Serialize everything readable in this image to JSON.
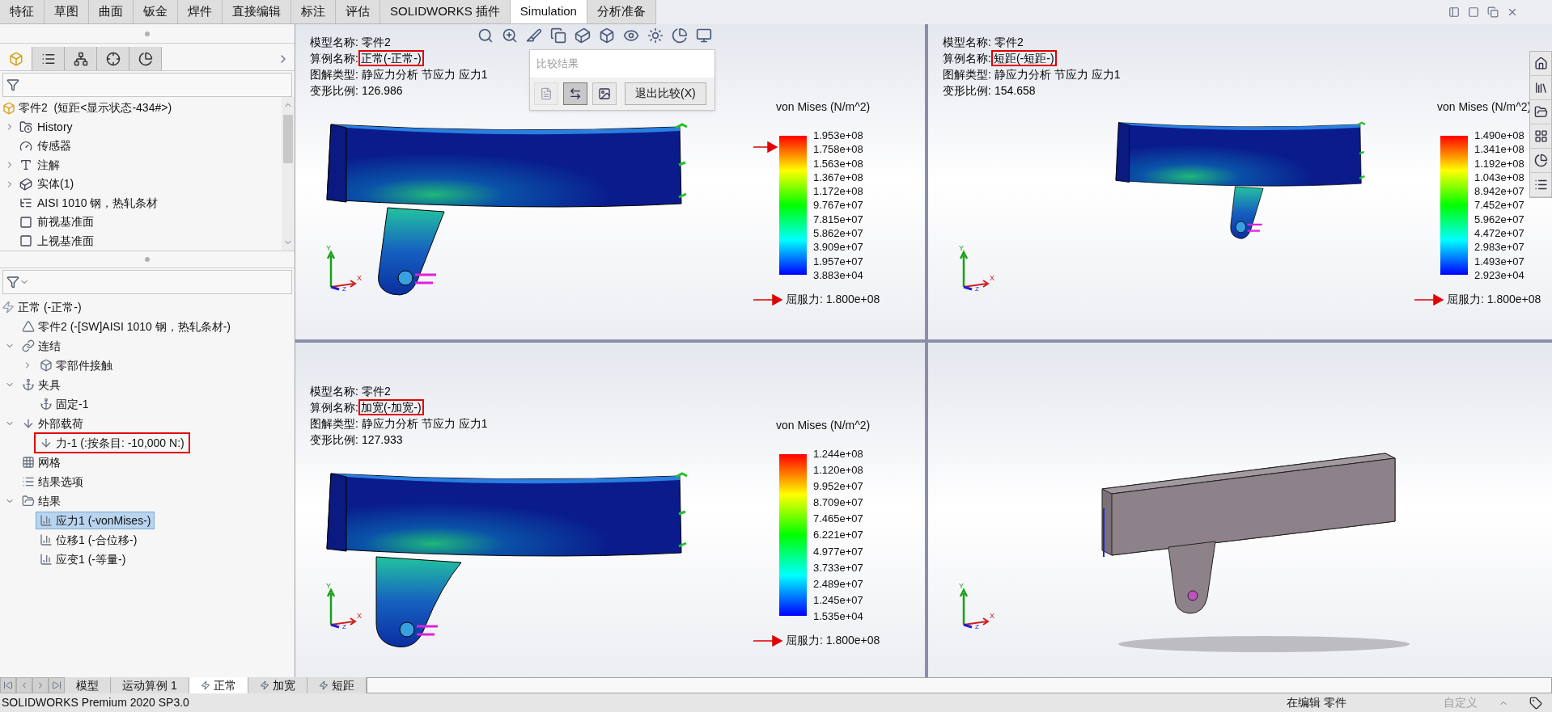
{
  "command_tabs": [
    {
      "label": "特征",
      "selected": false
    },
    {
      "label": "草图",
      "selected": false
    },
    {
      "label": "曲面",
      "selected": false
    },
    {
      "label": "钣金",
      "selected": false
    },
    {
      "label": "焊件",
      "selected": false
    },
    {
      "label": "直接编辑",
      "selected": false
    },
    {
      "label": "标注",
      "selected": false
    },
    {
      "label": "评估",
      "selected": false
    },
    {
      "label": "SOLIDWORKS 插件",
      "selected": false
    },
    {
      "label": "Simulation",
      "selected": true
    },
    {
      "label": "分析准备",
      "selected": false
    }
  ],
  "panel_tabs": [
    {
      "kind": "feature",
      "selected": true
    },
    {
      "kind": "property",
      "selected": false
    },
    {
      "kind": "config",
      "selected": false
    },
    {
      "kind": "dimxpert",
      "selected": false
    },
    {
      "kind": "display",
      "selected": false
    }
  ],
  "feature_tree": {
    "root": "零件2  (短距<显示状态-434#>)",
    "items": [
      {
        "label": "History",
        "kind": "history",
        "expanded": false
      },
      {
        "label": "传感器",
        "kind": "sensor"
      },
      {
        "label": "注解",
        "kind": "annotation",
        "expanded": false
      },
      {
        "label": "实体(1)",
        "kind": "solid",
        "expanded": false
      },
      {
        "label": "AISI 1010 钢，热轧条材",
        "kind": "material"
      },
      {
        "label": "前视基准面",
        "kind": "plane"
      },
      {
        "label": "上视基准面",
        "kind": "plane"
      }
    ]
  },
  "simulation_tree": {
    "root": "正常 (-正常-)",
    "items": [
      {
        "label": "零件2 (-[SW]AISI 1010 钢，热轧条材-)",
        "kind": "part",
        "selected": false,
        "boxed": false
      },
      {
        "label": "连结",
        "kind": "connection",
        "expanded": true,
        "selected": false,
        "boxed": false,
        "children": [
          {
            "label": "零部件接触",
            "kind": "contact",
            "expanded": false,
            "selected": false,
            "boxed": false
          }
        ]
      },
      {
        "label": "夹具",
        "kind": "fixture",
        "expanded": true,
        "selected": false,
        "boxed": false,
        "children": [
          {
            "label": "固定-1",
            "kind": "fixture",
            "selected": false,
            "boxed": false
          }
        ]
      },
      {
        "label": "外部载荷",
        "kind": "loads",
        "expanded": true,
        "selected": false,
        "boxed": false,
        "children": [
          {
            "label": "力-1 (:按条目: -10,000 N:)",
            "kind": "force",
            "selected": false,
            "boxed": true
          }
        ]
      },
      {
        "label": "网格",
        "kind": "mesh",
        "selected": false,
        "boxed": false
      },
      {
        "label": "结果选项",
        "kind": "options",
        "selected": false,
        "boxed": false
      },
      {
        "label": "结果",
        "kind": "results",
        "expanded": true,
        "selected": false,
        "boxed": false,
        "children": [
          {
            "label": "应力1 (-vonMises-)",
            "kind": "plot",
            "selected": true,
            "boxed": false
          },
          {
            "label": "位移1 (-合位移-)",
            "kind": "plot",
            "selected": false,
            "boxed": false
          },
          {
            "label": "应变1 (-等量-)",
            "kind": "plot",
            "selected": false,
            "boxed": false
          }
        ]
      }
    ]
  },
  "viewports": [
    {
      "kind": "result",
      "info": [
        {
          "label": "模型名称:",
          "value": "零件2",
          "boxed": false
        },
        {
          "label": "算例名称:",
          "value": "正常(-正常-)",
          "boxed": true
        },
        {
          "label": "图解类型:",
          "value": "静应力分析 节应力 应力1",
          "boxed": false
        },
        {
          "label": "变形比例:",
          "value": "126.986",
          "boxed": false
        }
      ],
      "legend": {
        "title": "von Mises (N/m^2)",
        "ticks": [
          "1.953e+08",
          "1.758e+08",
          "1.563e+08",
          "1.367e+08",
          "1.172e+08",
          "9.767e+07",
          "7.815e+07",
          "5.862e+07",
          "3.909e+07",
          "1.957e+07",
          "3.883e+04"
        ],
        "yield_marker": true,
        "yield_label": "屈服力: 1.800e+08"
      },
      "triad": [
        "Y",
        "X",
        "Z"
      ],
      "compare_popup": {
        "title": "比较结果",
        "buttons": [
          {
            "kind": "report",
            "disabled": true,
            "selected": false
          },
          {
            "kind": "swap",
            "disabled": false,
            "selected": true
          },
          {
            "kind": "image",
            "disabled": false,
            "selected": false
          }
        ],
        "exit_label": "退出比较(X)"
      }
    },
    {
      "kind": "result",
      "info": [
        {
          "label": "模型名称:",
          "value": "零件2",
          "boxed": false
        },
        {
          "label": "算例名称:",
          "value": "短距(-短距-)",
          "boxed": true
        },
        {
          "label": "图解类型:",
          "value": "静应力分析 节应力 应力1",
          "boxed": false
        },
        {
          "label": "变形比例:",
          "value": "154.658",
          "boxed": false
        }
      ],
      "legend": {
        "title": "von Mises (N/m^2)",
        "ticks": [
          "1.490e+08",
          "1.341e+08",
          "1.192e+08",
          "1.043e+08",
          "8.942e+07",
          "7.452e+07",
          "5.962e+07",
          "4.472e+07",
          "2.983e+07",
          "1.493e+07",
          "2.923e+04"
        ],
        "yield_marker": false,
        "yield_label": "屈服力: 1.800e+08"
      },
      "triad": [
        "Y",
        "X",
        "Z"
      ]
    },
    {
      "kind": "result",
      "info": [
        {
          "label": "模型名称:",
          "value": "零件2",
          "boxed": false
        },
        {
          "label": "算例名称:",
          "value": "加宽(-加宽-)",
          "boxed": true
        },
        {
          "label": "图解类型:",
          "value": "静应力分析 节应力 应力1",
          "boxed": false
        },
        {
          "label": "变形比例:",
          "value": "127.933",
          "boxed": false
        }
      ],
      "legend": {
        "title": "von Mises (N/m^2)",
        "ticks": [
          "1.244e+08",
          "1.120e+08",
          "9.952e+07",
          "8.709e+07",
          "7.465e+07",
          "6.221e+07",
          "4.977e+07",
          "3.733e+07",
          "2.489e+07",
          "1.245e+07",
          "1.535e+04"
        ],
        "yield_marker": false,
        "yield_label": "屈服力: 1.800e+08"
      },
      "triad": [
        "Y",
        "X",
        "Z"
      ]
    },
    {
      "kind": "model",
      "triad": [
        "Y",
        "X",
        "Z"
      ]
    }
  ],
  "bottom_tabs": [
    {
      "label": "模型",
      "kind": "plain",
      "selected": false
    },
    {
      "label": "运动算例 1",
      "kind": "plain",
      "selected": false
    },
    {
      "label": "正常",
      "kind": "study",
      "selected": true
    },
    {
      "label": "加宽",
      "kind": "study",
      "selected": false
    },
    {
      "label": "短距",
      "kind": "study",
      "selected": false
    }
  ],
  "status_bar": {
    "product": "SOLIDWORKS Premium 2020 SP3.0",
    "mode": "在编辑 零件",
    "customize": "自定义"
  }
}
